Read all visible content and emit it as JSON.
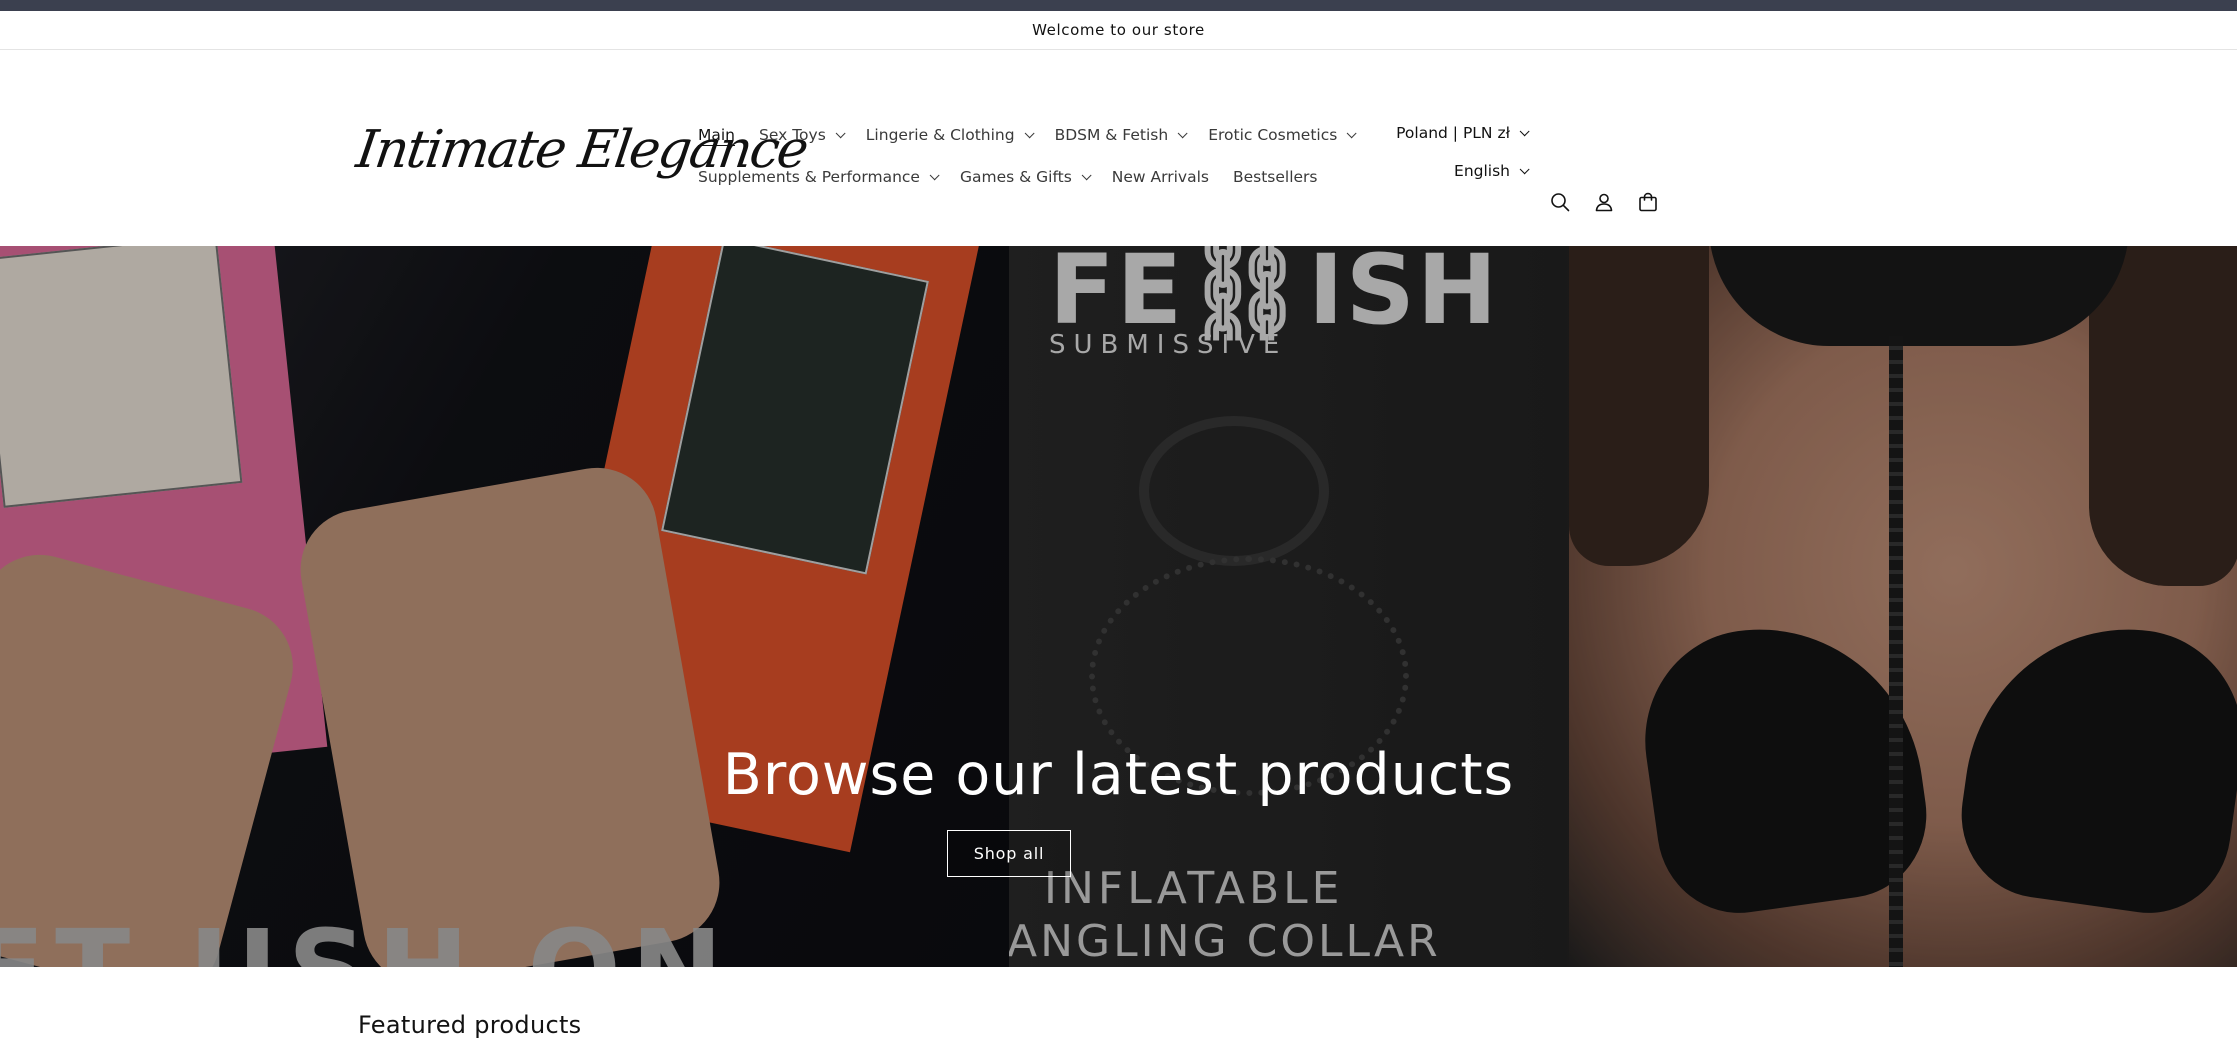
{
  "announcement": {
    "text": "Welcome to our store"
  },
  "header": {
    "logo_text": "Intimate Elegance",
    "nav": {
      "row1": [
        {
          "label": "Main",
          "active": true,
          "has_dropdown": false
        },
        {
          "label": "Sex Toys",
          "active": false,
          "has_dropdown": true
        },
        {
          "label": "Lingerie & Clothing",
          "active": false,
          "has_dropdown": true
        },
        {
          "label": "BDSM & Fetish",
          "active": false,
          "has_dropdown": true
        },
        {
          "label": "Erotic Cosmetics",
          "active": false,
          "has_dropdown": true
        }
      ],
      "row2": [
        {
          "label": "Supplements & Performance",
          "active": false,
          "has_dropdown": true
        },
        {
          "label": "Games & Gifts",
          "active": false,
          "has_dropdown": true
        },
        {
          "label": "New Arrivals",
          "active": false,
          "has_dropdown": false
        },
        {
          "label": "Bestsellers",
          "active": false,
          "has_dropdown": false
        }
      ]
    },
    "localization": {
      "country_currency": "Poland | PLN zł",
      "language": "English"
    },
    "icons": [
      "search-icon",
      "account-icon",
      "cart-icon"
    ]
  },
  "hero": {
    "heading": "Browse our latest products",
    "button_label": "Shop all",
    "image_text": {
      "fetish": "FE⛓ISH",
      "submissive": "SUBMISSIVE",
      "inflatable": "INFLATABLE",
      "angling_collar": "ANGLING COLLAR",
      "bottom_left": "FT USH ON"
    }
  },
  "featured": {
    "title": "Featured products"
  },
  "colors": {
    "topbar": "#3b404f",
    "text": "#121212",
    "hero_text": "#ffffff"
  }
}
